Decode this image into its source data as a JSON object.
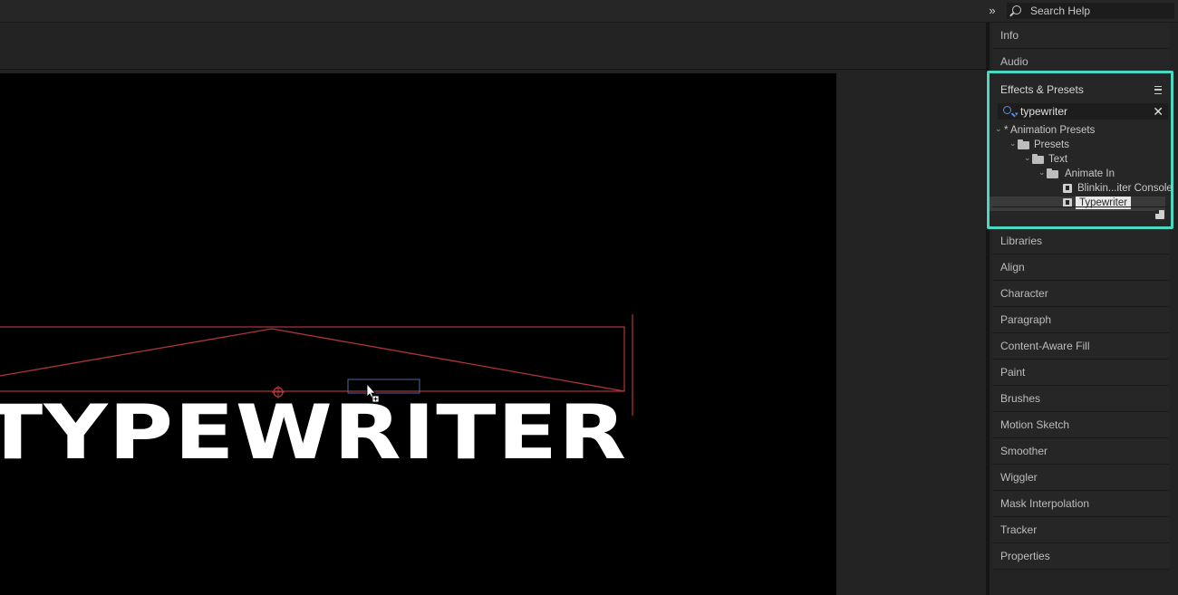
{
  "header": {
    "search_placeholder": "Search Help",
    "expand_label": "»"
  },
  "composition": {
    "text": "TYPEWRITER"
  },
  "panels_top": [
    {
      "label": "Info"
    },
    {
      "label": "Audio"
    }
  ],
  "effects_presets": {
    "title": "Effects & Presets",
    "search_value": "typewriter",
    "tree": [
      {
        "label": "* Animation Presets"
      },
      {
        "label": "Presets"
      },
      {
        "label": "Text"
      },
      {
        "label": "Animate In"
      },
      {
        "label": "Blinkin...iter Console"
      },
      {
        "label": "Typewriter"
      }
    ]
  },
  "panels_bottom": [
    {
      "label": "Libraries"
    },
    {
      "label": "Align"
    },
    {
      "label": "Character"
    },
    {
      "label": "Paragraph"
    },
    {
      "label": "Content-Aware Fill"
    },
    {
      "label": "Paint"
    },
    {
      "label": "Brushes"
    },
    {
      "label": "Motion Sketch"
    },
    {
      "label": "Smoother"
    },
    {
      "label": "Wiggler"
    },
    {
      "label": "Mask Interpolation"
    },
    {
      "label": "Tracker"
    },
    {
      "label": "Properties"
    }
  ],
  "colors": {
    "highlight_border": "#4ad8c0",
    "bounding_box": "#b0353a",
    "search_icon_accent": "#4d93e8"
  }
}
